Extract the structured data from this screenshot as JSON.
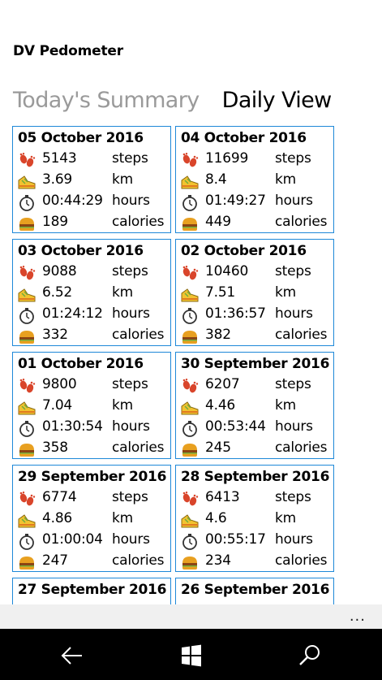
{
  "app": {
    "title": "DV Pedometer"
  },
  "pivot": {
    "tabs": [
      {
        "label": "Today's Summary"
      },
      {
        "label": "Daily View"
      }
    ]
  },
  "units": {
    "steps": "steps",
    "distance": "km",
    "time": "hours",
    "calories": "calories"
  },
  "icons": {
    "steps": "footprints-icon",
    "distance": "shoe-icon",
    "time": "stopwatch-icon",
    "calories": "burger-icon"
  },
  "colors": {
    "accent": "#1e88d8",
    "appbar": "#f0f0f0",
    "navbar": "#000000"
  },
  "days": [
    {
      "date": "05 October 2016",
      "steps": "5143",
      "km": "3.69",
      "time": "00:44:29",
      "calories": "189"
    },
    {
      "date": "04 October 2016",
      "steps": "11699",
      "km": "8.4",
      "time": "01:49:27",
      "calories": "449"
    },
    {
      "date": "03 October 2016",
      "steps": "9088",
      "km": "6.52",
      "time": "01:24:12",
      "calories": "332"
    },
    {
      "date": "02 October 2016",
      "steps": "10460",
      "km": "7.51",
      "time": "01:36:57",
      "calories": "382"
    },
    {
      "date": "01 October 2016",
      "steps": "9800",
      "km": "7.04",
      "time": "01:30:54",
      "calories": "358"
    },
    {
      "date": "30 September 2016",
      "steps": "6207",
      "km": "4.46",
      "time": "00:53:44",
      "calories": "245"
    },
    {
      "date": "29 September 2016",
      "steps": "6774",
      "km": "4.86",
      "time": "01:00:04",
      "calories": "247"
    },
    {
      "date": "28 September 2016",
      "steps": "6413",
      "km": "4.6",
      "time": "00:55:17",
      "calories": "234"
    },
    {
      "date": "27 September 2016",
      "steps": "",
      "km": "",
      "time": "",
      "calories": ""
    },
    {
      "date": "26 September 2016",
      "steps": "",
      "km": "",
      "time": "",
      "calories": ""
    }
  ],
  "appbar": {
    "more_label": "..."
  }
}
